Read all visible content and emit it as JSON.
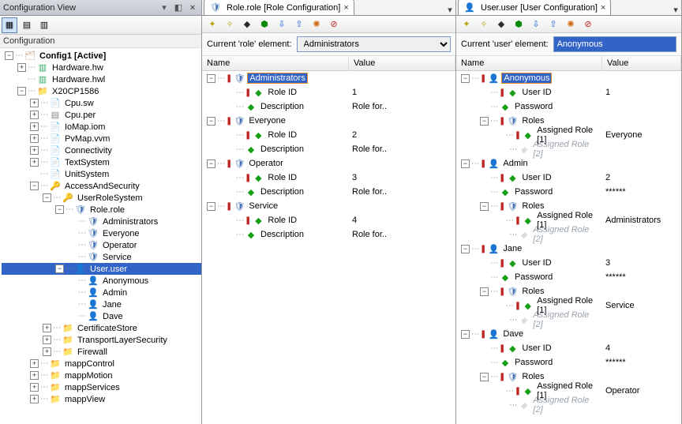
{
  "config_pane": {
    "title": "Configuration View",
    "heading": "Configuration",
    "tree": [
      {
        "d": 0,
        "exp": "-",
        "icon": "i-cfg",
        "label": "Config1 [Active]",
        "bold": true
      },
      {
        "d": 1,
        "exp": "+",
        "icon": "i-disk",
        "label": "Hardware.hw"
      },
      {
        "d": 1,
        "exp": "",
        "icon": "i-disk",
        "label": "Hardware.hwl"
      },
      {
        "d": 1,
        "exp": "-",
        "icon": "i-folder",
        "label": "X20CP1586"
      },
      {
        "d": 2,
        "exp": "+",
        "icon": "i-file",
        "label": "Cpu.sw"
      },
      {
        "d": 2,
        "exp": "+",
        "icon": "i-chip",
        "label": "Cpu.per"
      },
      {
        "d": 2,
        "exp": "+",
        "icon": "i-file",
        "label": "IoMap.iom"
      },
      {
        "d": 2,
        "exp": "+",
        "icon": "i-file",
        "label": "PvMap.vvm"
      },
      {
        "d": 2,
        "exp": "+",
        "icon": "i-file",
        "label": "Connectivity"
      },
      {
        "d": 2,
        "exp": "+",
        "icon": "i-file",
        "label": "TextSystem"
      },
      {
        "d": 2,
        "exp": "",
        "icon": "i-file",
        "label": "UnitSystem"
      },
      {
        "d": 2,
        "exp": "-",
        "icon": "i-key",
        "label": "AccessAndSecurity"
      },
      {
        "d": 3,
        "exp": "-",
        "icon": "i-key",
        "label": "UserRoleSystem"
      },
      {
        "d": 4,
        "exp": "-",
        "icon": "i-role",
        "label": "Role.role"
      },
      {
        "d": 5,
        "exp": "",
        "icon": "i-role",
        "label": "Administrators"
      },
      {
        "d": 5,
        "exp": "",
        "icon": "i-role",
        "label": "Everyone"
      },
      {
        "d": 5,
        "exp": "",
        "icon": "i-role",
        "label": "Operator"
      },
      {
        "d": 5,
        "exp": "",
        "icon": "i-role",
        "label": "Service"
      },
      {
        "d": 4,
        "exp": "-",
        "icon": "i-user",
        "label": "User.user",
        "sel": true
      },
      {
        "d": 5,
        "exp": "",
        "icon": "i-user",
        "label": "Anonymous"
      },
      {
        "d": 5,
        "exp": "",
        "icon": "i-user",
        "label": "Admin"
      },
      {
        "d": 5,
        "exp": "",
        "icon": "i-user",
        "label": "Jane"
      },
      {
        "d": 5,
        "exp": "",
        "icon": "i-user",
        "label": "Dave"
      },
      {
        "d": 3,
        "exp": "+",
        "icon": "i-folder",
        "label": "CertificateStore"
      },
      {
        "d": 3,
        "exp": "+",
        "icon": "i-folder",
        "label": "TransportLayerSecurity"
      },
      {
        "d": 3,
        "exp": "+",
        "icon": "i-folder",
        "label": "Firewall"
      },
      {
        "d": 2,
        "exp": "+",
        "icon": "i-folder",
        "label": "mappControl"
      },
      {
        "d": 2,
        "exp": "+",
        "icon": "i-folder",
        "label": "mappMotion"
      },
      {
        "d": 2,
        "exp": "+",
        "icon": "i-folder",
        "label": "mappServices"
      },
      {
        "d": 2,
        "exp": "+",
        "icon": "i-folder",
        "label": "mappView"
      }
    ]
  },
  "role_pane": {
    "tab_icon": "i-role",
    "tab_label": "Role.role [Role Configuration]",
    "elem_label": "Current 'role' element:",
    "elem_value": "Administrators",
    "columns": {
      "name": "Name",
      "value": "Value"
    },
    "rows": [
      {
        "d": 0,
        "exp": "-",
        "mark": true,
        "icon": "i-role",
        "label": "Administrators",
        "val": "",
        "sel": true
      },
      {
        "d": 1,
        "exp": "",
        "mark": true,
        "icon": "i-grn",
        "label": "Role ID",
        "val": "1"
      },
      {
        "d": 1,
        "exp": "",
        "mark": false,
        "icon": "i-grn",
        "label": "Description",
        "val": "Role for.."
      },
      {
        "d": 0,
        "exp": "-",
        "mark": true,
        "icon": "i-role",
        "label": "Everyone",
        "val": ""
      },
      {
        "d": 1,
        "exp": "",
        "mark": true,
        "icon": "i-grn",
        "label": "Role ID",
        "val": "2"
      },
      {
        "d": 1,
        "exp": "",
        "mark": false,
        "icon": "i-grn",
        "label": "Description",
        "val": "Role for.."
      },
      {
        "d": 0,
        "exp": "-",
        "mark": true,
        "icon": "i-role",
        "label": "Operator",
        "val": ""
      },
      {
        "d": 1,
        "exp": "",
        "mark": true,
        "icon": "i-grn",
        "label": "Role ID",
        "val": "3"
      },
      {
        "d": 1,
        "exp": "",
        "mark": false,
        "icon": "i-grn",
        "label": "Description",
        "val": "Role for.."
      },
      {
        "d": 0,
        "exp": "-",
        "mark": true,
        "icon": "i-role",
        "label": "Service",
        "val": ""
      },
      {
        "d": 1,
        "exp": "",
        "mark": true,
        "icon": "i-grn",
        "label": "Role ID",
        "val": "4"
      },
      {
        "d": 1,
        "exp": "",
        "mark": false,
        "icon": "i-grn",
        "label": "Description",
        "val": "Role for.."
      }
    ]
  },
  "user_pane": {
    "tab_icon": "i-user",
    "tab_label": "User.user [User Configuration]",
    "elem_label": "Current 'user' element:",
    "elem_value": "Anonymous",
    "columns": {
      "name": "Name",
      "value": "Value"
    },
    "rows": [
      {
        "d": 0,
        "exp": "-",
        "mark": true,
        "icon": "i-user",
        "label": "Anonymous",
        "val": "",
        "sel": true
      },
      {
        "d": 1,
        "exp": "",
        "mark": true,
        "icon": "i-grn",
        "label": "User ID",
        "val": "1"
      },
      {
        "d": 1,
        "exp": "",
        "mark": false,
        "icon": "i-grn",
        "label": "Password",
        "val": ""
      },
      {
        "d": 1,
        "exp": "-",
        "mark": true,
        "icon": "i-role",
        "label": "Roles",
        "val": ""
      },
      {
        "d": 2,
        "exp": "",
        "mark": true,
        "icon": "i-grn",
        "label": "Assigned Role [1]",
        "val": "Everyone"
      },
      {
        "d": 2,
        "exp": "",
        "mark": false,
        "icon": "i-gry",
        "label": "Assigned Role [2]",
        "val": "",
        "ghost": true
      },
      {
        "d": 0,
        "exp": "-",
        "mark": true,
        "icon": "i-user",
        "label": "Admin",
        "val": ""
      },
      {
        "d": 1,
        "exp": "",
        "mark": true,
        "icon": "i-grn",
        "label": "User ID",
        "val": "2"
      },
      {
        "d": 1,
        "exp": "",
        "mark": false,
        "icon": "i-grn",
        "label": "Password",
        "val": "******"
      },
      {
        "d": 1,
        "exp": "-",
        "mark": true,
        "icon": "i-role",
        "label": "Roles",
        "val": ""
      },
      {
        "d": 2,
        "exp": "",
        "mark": true,
        "icon": "i-grn",
        "label": "Assigned Role [1]",
        "val": "Administrators"
      },
      {
        "d": 2,
        "exp": "",
        "mark": false,
        "icon": "i-gry",
        "label": "Assigned Role [2]",
        "val": "",
        "ghost": true
      },
      {
        "d": 0,
        "exp": "-",
        "mark": true,
        "icon": "i-user",
        "label": "Jane",
        "val": ""
      },
      {
        "d": 1,
        "exp": "",
        "mark": true,
        "icon": "i-grn",
        "label": "User ID",
        "val": "3"
      },
      {
        "d": 1,
        "exp": "",
        "mark": false,
        "icon": "i-grn",
        "label": "Password",
        "val": "******"
      },
      {
        "d": 1,
        "exp": "-",
        "mark": true,
        "icon": "i-role",
        "label": "Roles",
        "val": ""
      },
      {
        "d": 2,
        "exp": "",
        "mark": true,
        "icon": "i-grn",
        "label": "Assigned Role [1]",
        "val": "Service"
      },
      {
        "d": 2,
        "exp": "",
        "mark": false,
        "icon": "i-gry",
        "label": "Assigned Role [2]",
        "val": "",
        "ghost": true
      },
      {
        "d": 0,
        "exp": "-",
        "mark": true,
        "icon": "i-user",
        "label": "Dave",
        "val": ""
      },
      {
        "d": 1,
        "exp": "",
        "mark": true,
        "icon": "i-grn",
        "label": "User ID",
        "val": "4"
      },
      {
        "d": 1,
        "exp": "",
        "mark": false,
        "icon": "i-grn",
        "label": "Password",
        "val": "******"
      },
      {
        "d": 1,
        "exp": "-",
        "mark": true,
        "icon": "i-role",
        "label": "Roles",
        "val": ""
      },
      {
        "d": 2,
        "exp": "",
        "mark": true,
        "icon": "i-grn",
        "label": "Assigned Role [1]",
        "val": "Operator"
      },
      {
        "d": 2,
        "exp": "",
        "mark": false,
        "icon": "i-gry",
        "label": "Assigned Role [2]",
        "val": "",
        "ghost": true
      }
    ]
  }
}
